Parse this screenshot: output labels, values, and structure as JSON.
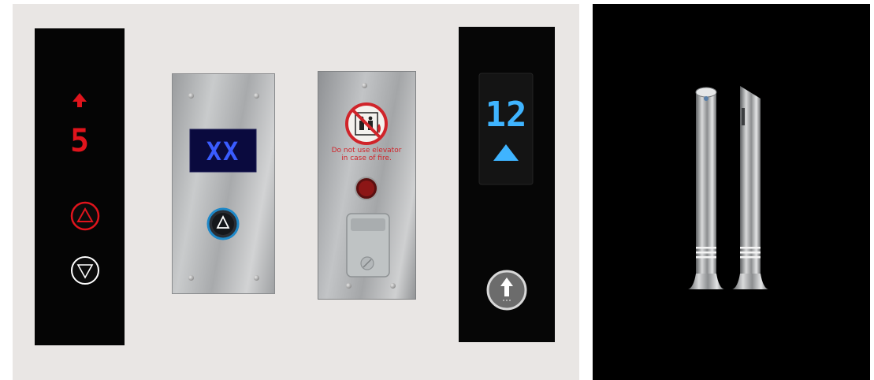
{
  "panels": {
    "left_display": {
      "floor_number": "5",
      "direction": "up"
    },
    "blue_matrix": {
      "display_text": "XX"
    },
    "fire_panel": {
      "warning_line1": "Do not use elevator",
      "warning_line2": "in case of fire."
    },
    "right_display": {
      "floor_number": "12",
      "direction": "up"
    }
  },
  "colors": {
    "red_led": "#e0141c",
    "blue_led": "#3a5cff",
    "cyan_led": "#3fb4ff",
    "panel_black": "#050505",
    "steel": "#b9bbbd"
  },
  "icons": [
    "arrow-up-icon",
    "triangle-up-button-icon",
    "triangle-down-button-icon",
    "no-elevator-fire-icon",
    "arrow-up-circle-icon"
  ]
}
